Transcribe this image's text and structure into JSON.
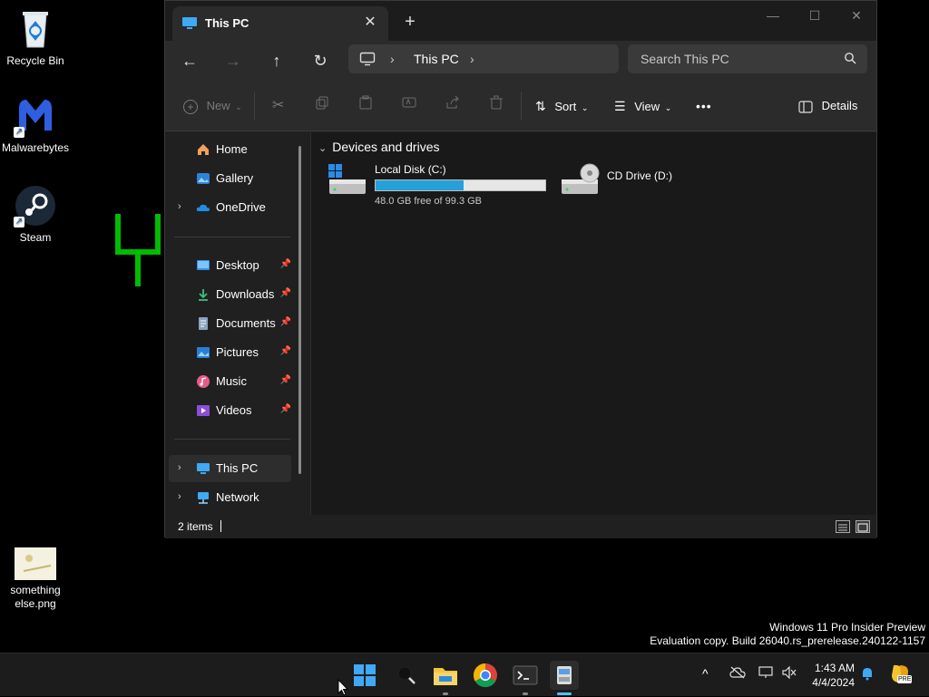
{
  "desktop": {
    "icons": [
      {
        "label": "Recycle Bin"
      },
      {
        "label": "Malwarebytes"
      },
      {
        "label": "Steam"
      },
      {
        "label_line1": "something",
        "label_line2": "else.png"
      }
    ]
  },
  "window": {
    "tab_title": "This PC",
    "tab_close": "✕",
    "new_tab": "+",
    "minimize": "—",
    "maximize": "☐",
    "close": "✕"
  },
  "nav": {
    "back": "←",
    "forward": "→",
    "up": "↑",
    "refresh": "↻",
    "breadcrumb": [
      "This PC"
    ],
    "search_placeholder": "Search This PC"
  },
  "toolbar": {
    "new_label": "New",
    "sort_label": "Sort",
    "view_label": "View",
    "more_label": "•••",
    "details_label": "Details"
  },
  "sidebar": {
    "items": [
      {
        "label": "Home",
        "pin": false
      },
      {
        "label": "Gallery",
        "pin": false
      },
      {
        "label": "OneDrive",
        "pin": false,
        "expandable": true
      },
      {
        "label": "Desktop",
        "pin": true
      },
      {
        "label": "Downloads",
        "pin": true
      },
      {
        "label": "Documents",
        "pin": true
      },
      {
        "label": "Pictures",
        "pin": true
      },
      {
        "label": "Music",
        "pin": true
      },
      {
        "label": "Videos",
        "pin": true
      },
      {
        "label": "This PC",
        "selected": true,
        "expandable": true
      },
      {
        "label": "Network",
        "expandable": true
      }
    ]
  },
  "content": {
    "group_title": "Devices and drives",
    "drives": [
      {
        "name": "Local Disk (C:)",
        "free_text": "48.0 GB free of 99.3 GB",
        "used_fraction": 0.517
      },
      {
        "name": "CD Drive (D:)"
      }
    ]
  },
  "status": {
    "item_count": "2 items"
  },
  "watermark": {
    "line1": "Windows 11 Pro Insider Preview",
    "line2": "Evaluation copy. Build 26040.rs_prerelease.240122-1157"
  },
  "taskbar": {
    "time": "1:43 AM",
    "date": "4/4/2024",
    "tray_badge": "PRE"
  },
  "colors": {
    "accent": "#26a0da",
    "window_bg": "#202020",
    "toolbar_bg": "#2b2b2b",
    "taskbar_bg": "#1c1c1c"
  }
}
